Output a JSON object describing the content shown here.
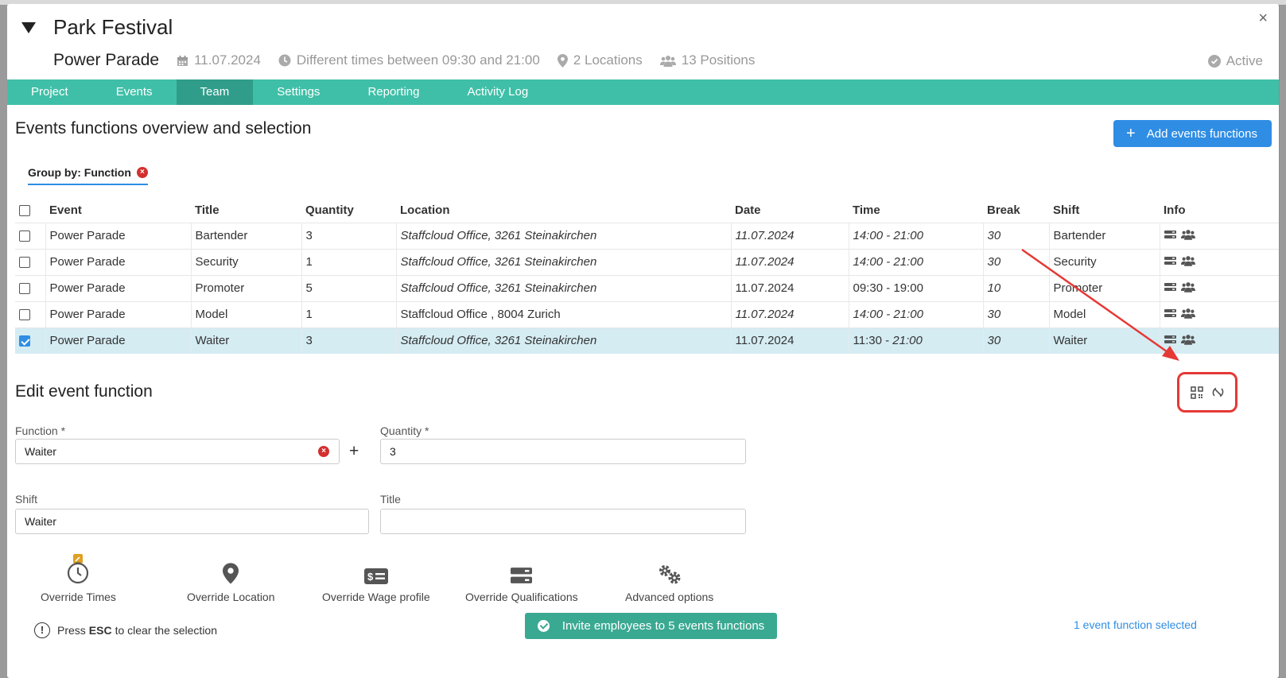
{
  "header": {
    "project_title": "Park Festival",
    "event_name": "Power Parade",
    "date": "11.07.2024",
    "times": "Different times between 09:30 and 21:00",
    "locations": "2 Locations",
    "positions": "13 Positions",
    "status": "Active",
    "close": "×"
  },
  "tabs": [
    {
      "label": "Project"
    },
    {
      "label": "Events"
    },
    {
      "label": "Team",
      "active": true
    },
    {
      "label": "Settings"
    },
    {
      "label": "Reporting"
    },
    {
      "label": "Activity Log"
    }
  ],
  "overview": {
    "title": "Events functions overview and selection",
    "add_button": "Add events functions",
    "group_by": "Group by: Function"
  },
  "table": {
    "headers": [
      "Event",
      "Title",
      "Quantity",
      "Location",
      "Date",
      "Time",
      "Break",
      "Shift",
      "Info"
    ],
    "rows": [
      {
        "event": "Power Parade",
        "title": "Bartender",
        "quantity": "3",
        "location": "Staffcloud Office, 3261 Steinakirchen",
        "date": "11.07.2024",
        "time_start": "14:00",
        "time_end": "21:00",
        "break": "30",
        "shift": "Bartender",
        "checked": false
      },
      {
        "event": "Power Parade",
        "title": "Security",
        "quantity": "1",
        "location": "Staffcloud Office, 3261 Steinakirchen",
        "date": "11.07.2024",
        "time_start": "14:00",
        "time_end": "21:00",
        "break": "30",
        "shift": "Security",
        "checked": false
      },
      {
        "event": "Power Parade",
        "title": "Promoter",
        "quantity": "5",
        "location": "Staffcloud Office, 3261 Steinakirchen",
        "date": "11.07.2024",
        "time_start": "09:30",
        "time_end": "19:00",
        "break": "10",
        "shift": "Promoter",
        "checked": false
      },
      {
        "event": "Power Parade",
        "title": "Model",
        "quantity": "1",
        "location": "Staffcloud Office , 8004 Zurich",
        "date": "11.07.2024",
        "time_start": "14:00",
        "time_end": "21:00",
        "break": "30",
        "shift": "Model",
        "checked": false
      },
      {
        "event": "Power Parade",
        "title": "Waiter",
        "quantity": "3",
        "location": "Staffcloud Office, 3261 Steinakirchen",
        "date": "11.07.2024",
        "time_start": "11:30",
        "time_end": "21:00",
        "break": "30",
        "shift": "Waiter",
        "checked": true
      }
    ]
  },
  "edit": {
    "title": "Edit event function",
    "function_label": "Function *",
    "function_value": "Waiter",
    "quantity_label": "Quantity *",
    "quantity_value": "3",
    "shift_label": "Shift",
    "shift_value": "Waiter",
    "title_label": "Title",
    "title_value": "",
    "overrides": [
      "Override Times",
      "Override Location",
      "Override Wage profile",
      "Override Qualifications",
      "Advanced options"
    ]
  },
  "footer": {
    "esc_prefix": "Press",
    "esc_key": "ESC",
    "esc_suffix": "to clear the selection",
    "invite_button": "Invite employees to 5 events functions",
    "selected_count": "1 event function selected"
  },
  "colors": {
    "nav_bg": "#3fbfa7",
    "nav_active": "#2f9d8a",
    "primary_blue": "#2f8de4",
    "invite_green": "#3aa992",
    "selected_row": "#d5ecf3",
    "annotation_red": "#e53935"
  }
}
